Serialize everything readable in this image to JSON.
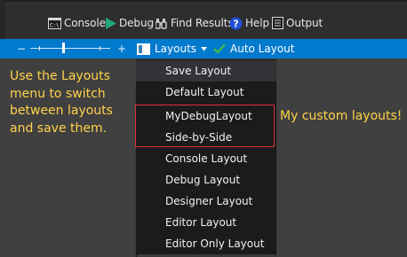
{
  "toolbar": {
    "items": [
      {
        "label": "Console"
      },
      {
        "label": "Debug"
      },
      {
        "label": "Find Results"
      },
      {
        "label": "Help"
      },
      {
        "label": "Output"
      }
    ]
  },
  "statusbar": {
    "zoom_minus": "−",
    "zoom_plus": "+",
    "layouts_label": "Layouts",
    "auto_layout_label": "Auto Layout"
  },
  "annotation": {
    "hint": "Use the Layouts menu to switch between layouts and save them.",
    "custom_callout": "My custom layouts!"
  },
  "layouts_menu": {
    "items": [
      {
        "label": "Save Layout"
      },
      {
        "label": "Default Layout"
      },
      {
        "label": "MyDebugLayout"
      },
      {
        "label": "Side-by-Side"
      },
      {
        "label": "Console Layout"
      },
      {
        "label": "Debug Layout"
      },
      {
        "label": "Designer Layout"
      },
      {
        "label": "Editor Layout"
      },
      {
        "label": "Editor Only Layout"
      }
    ],
    "highlighted_index": 0
  },
  "colors": {
    "accent_blue": "#007acc",
    "annotation_yellow": "#ffd24a",
    "highlight_red": "#e0323a",
    "check_green": "#3fb950"
  }
}
